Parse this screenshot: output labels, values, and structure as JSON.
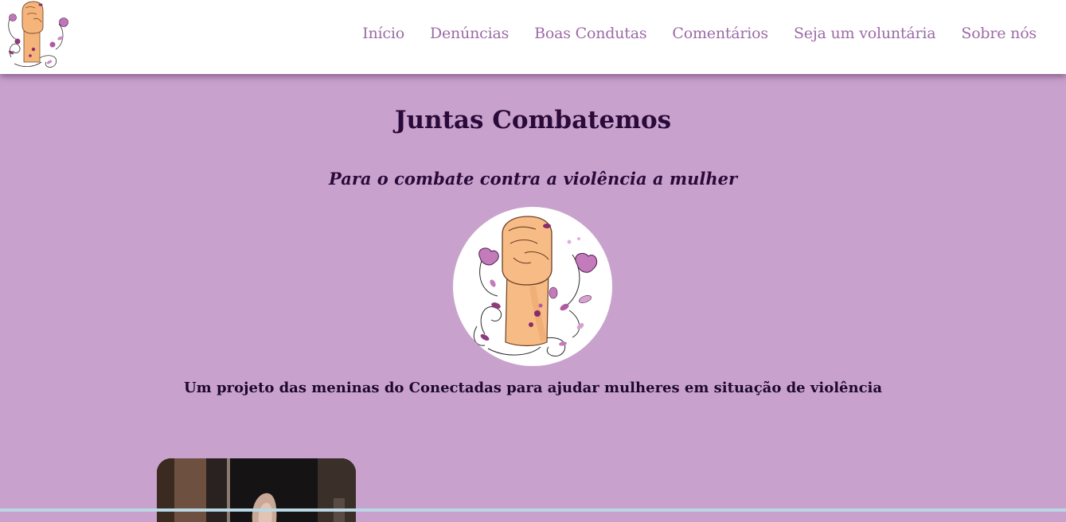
{
  "nav": {
    "items": [
      {
        "label": "Início"
      },
      {
        "label": "Denúncias"
      },
      {
        "label": "Boas Condutas"
      },
      {
        "label": "Comentários"
      },
      {
        "label": "Seja um voluntária"
      },
      {
        "label": "Sobre nós"
      }
    ]
  },
  "hero": {
    "title": "Juntas Combatemos",
    "subtitle": "Para o combate contra a violência a mulher",
    "tagline": "Um projeto das meninas do Conectadas para ajudar mulheres em situação de violência"
  },
  "icons": {
    "logo": "raised-fist-flowers-logo",
    "hero_logo": "raised-fist-flowers-logo"
  },
  "colors": {
    "background": "#c8a2cc",
    "nav_link": "#9c6aa6",
    "heading": "#2a0a3a",
    "header_bg": "#ffffff"
  }
}
